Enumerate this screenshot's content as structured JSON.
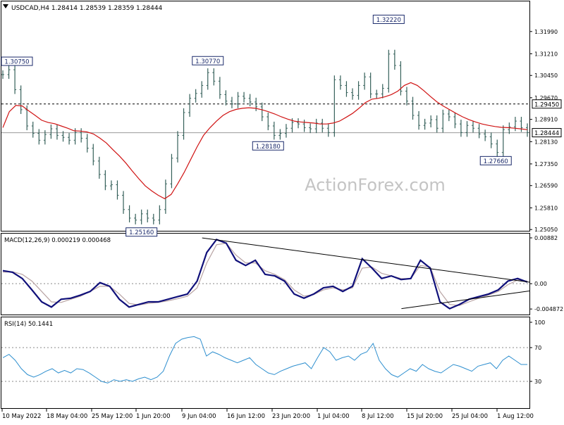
{
  "header": {
    "symbol_line": "USDCAD,H4  1.28414 1.28539 1.28359 1.28444",
    "watermark": "ActionForex.com"
  },
  "colors": {
    "price_bar": "#35605a",
    "ma_line": "#d01414",
    "macd_line": "#10107a",
    "signal_line": "#b8a3a3",
    "rsi_line": "#2e8fcf",
    "trendline": "#000000",
    "grid_text": "#000000",
    "watermark": "#c4c4c4"
  },
  "chart_data": [
    {
      "panel": "price",
      "type": "ohlc-bar",
      "title": "USDCAD,H4  1.28414 1.28539 1.28359 1.28444",
      "ylim": [
        1.2503,
        1.327
      ],
      "y_ticks": [
        "1.31990",
        "1.31210",
        "1.30450",
        "1.29670",
        "1.28910",
        "1.28130",
        "1.27350",
        "1.26590",
        "1.25810",
        "1.25050"
      ],
      "x_ticks": [
        "10 May 2022",
        "18 May 04:00",
        "25 May 12:00",
        "1 Jun 20:00",
        "9 Jun 04:00",
        "16 Jun 12:00",
        "23 Jun 20:00",
        "1 Jul 04:00",
        "8 Jul 12:00",
        "15 Jul 20:00",
        "25 Jul 04:00",
        "1 Aug 12:00"
      ],
      "series": [
        {
          "type": "line",
          "values": [
            1.3048,
            1.3065,
            1.2995,
            1.2925,
            1.2868,
            1.2842,
            1.2818,
            1.2838,
            1.2858,
            1.2835,
            1.2828,
            1.2818,
            1.2845,
            1.2825,
            1.279,
            1.2745,
            1.2698,
            1.2658,
            1.2662,
            1.2625,
            1.2575,
            1.2545,
            1.2538,
            1.256,
            1.2545,
            1.2538,
            1.2575,
            1.2665,
            1.2755,
            1.2835,
            1.2915,
            1.2965,
            1.2982,
            1.301,
            1.3055,
            1.3025,
            1.2978,
            1.2955,
            1.2945,
            1.2972,
            1.2965,
            1.2952,
            1.2935,
            1.29,
            1.2868,
            1.2835,
            1.2842,
            1.286,
            1.288,
            1.2875,
            1.2862,
            1.2858,
            1.2878,
            1.286,
            1.2845,
            1.303,
            1.301,
            1.2985,
            1.2975,
            1.301,
            1.304,
            1.298,
            1.298,
            1.3,
            1.312,
            1.308,
            1.299,
            1.2955,
            1.2905,
            1.287,
            1.2878,
            1.289,
            1.286,
            1.291,
            1.29,
            1.2875,
            1.2845,
            1.287,
            1.286,
            1.284,
            1.283,
            1.2805,
            1.2775,
            1.2855,
            1.2865,
            1.2885,
            1.2862,
            1.2845
          ]
        },
        {
          "name": "MA",
          "type": "line",
          "values": [
            1.2862,
            1.2918,
            1.294,
            1.2938,
            1.2921,
            1.2905,
            1.2888,
            1.288,
            1.2876,
            1.2868,
            1.286,
            1.2851,
            1.285,
            1.2847,
            1.284,
            1.2825,
            1.2808,
            1.2785,
            1.2763,
            1.2738,
            1.271,
            1.2683,
            1.2658,
            1.264,
            1.2625,
            1.2613,
            1.2628,
            1.2665,
            1.2705,
            1.275,
            1.2795,
            1.2835,
            1.2862,
            1.2885,
            1.2905,
            1.2918,
            1.2926,
            1.293,
            1.2932,
            1.293,
            1.2925,
            1.2918,
            1.291,
            1.29,
            1.2892,
            1.2885,
            1.2882,
            1.288,
            1.2878,
            1.2875,
            1.2875,
            1.2878,
            1.2885,
            1.2898,
            1.2912,
            1.293,
            1.295,
            1.2962,
            1.2965,
            1.297,
            1.2978,
            1.299,
            1.301,
            1.302,
            1.301,
            1.2992,
            1.2972,
            1.2953,
            1.2938,
            1.2925,
            1.2912,
            1.29,
            1.289,
            1.2882,
            1.2875,
            1.287,
            1.2866,
            1.2863,
            1.2862,
            1.286,
            1.2858,
            1.2855
          ]
        }
      ],
      "reference_lines": [
        {
          "value": 1.2945,
          "label": "1.29450",
          "style": "dashed"
        },
        {
          "value": 1.28444,
          "label": "1.28444",
          "style": "solid"
        }
      ],
      "annotations": [
        "1.30750",
        "1.30770",
        "1.32220",
        "1.28180",
        "1.25160",
        "1.27660"
      ]
    },
    {
      "panel": "macd",
      "type": "line",
      "title": "MACD(12,26,9) 0.000219 0.000468",
      "ylim": [
        -0.0058,
        0.0095
      ],
      "y_ticks": [
        "0.00882",
        "0.00",
        "-0.004872"
      ],
      "series": [
        {
          "type": "line",
          "values": [
            0.0025,
            0.0022,
            0.001,
            -0.0012,
            -0.0035,
            -0.0045,
            -0.003,
            -0.0028,
            -0.0022,
            -0.0015,
            0.0002,
            -0.0005,
            -0.003,
            -0.0045,
            -0.004,
            -0.0035,
            -0.0035,
            -0.003,
            -0.0025,
            -0.002,
            0.0005,
            0.006,
            0.0085,
            0.0078,
            0.0045,
            0.0035,
            0.0045,
            0.0018,
            0.0015,
            0.0005,
            -0.002,
            -0.0028,
            -0.002,
            -0.0008,
            -0.0005,
            -0.0015,
            -0.0005,
            0.0048,
            0.003,
            0.001,
            0.0015,
            0.0008,
            0.001,
            0.0045,
            0.003,
            -0.0035,
            -0.0048,
            -0.004,
            -0.003,
            -0.0025,
            -0.002,
            -0.0012,
            0.0005,
            0.001,
            0.0003
          ]
        },
        {
          "name": "Signal",
          "type": "line",
          "values": [
            0.0022,
            0.0023,
            0.0018,
            0.0005,
            -0.0015,
            -0.0035,
            -0.0036,
            -0.003,
            -0.0024,
            -0.0015,
            -0.0005,
            -0.0005,
            -0.002,
            -0.0038,
            -0.0041,
            -0.0038,
            -0.0036,
            -0.0033,
            -0.0029,
            -0.0024,
            -0.0008,
            0.004,
            0.0075,
            0.0078,
            0.0055,
            0.004,
            0.004,
            0.0025,
            0.0018,
            0.0008,
            -0.0012,
            -0.0024,
            -0.0021,
            -0.0012,
            -0.0008,
            -0.0012,
            -0.0008,
            0.003,
            0.0032,
            0.002,
            0.0015,
            0.001,
            0.001,
            0.0035,
            0.0032,
            -0.0015,
            -0.004,
            -0.0042,
            -0.0035,
            -0.0028,
            -0.0022,
            -0.0015,
            -0.0002,
            0.0007,
            0.0005
          ]
        }
      ],
      "trendlines": [
        {
          "from": [
            0.38,
            0.0088
          ],
          "to": [
            1.0,
            0.0003
          ]
        },
        {
          "from": [
            0.76,
            -0.0048
          ],
          "to": [
            1.0,
            -0.0014
          ]
        }
      ]
    },
    {
      "panel": "rsi",
      "type": "line",
      "title": "RSI(14) 50.1441",
      "ylim": [
        0,
        100
      ],
      "y_ticks": [
        "100",
        "70",
        "30",
        "0"
      ],
      "levels": [
        70,
        30
      ],
      "series": [
        {
          "type": "line",
          "values": [
            58,
            62,
            55,
            45,
            38,
            35,
            38,
            42,
            45,
            40,
            43,
            40,
            45,
            44,
            40,
            35,
            30,
            28,
            32,
            30,
            32,
            30,
            33,
            35,
            32,
            35,
            42,
            60,
            75,
            80,
            82,
            83,
            80,
            60,
            65,
            62,
            58,
            55,
            52,
            55,
            58,
            50,
            45,
            40,
            38,
            42,
            45,
            48,
            50,
            52,
            45,
            58,
            70,
            65,
            55,
            58,
            60,
            55,
            62,
            65,
            75,
            55,
            45,
            38,
            35,
            40,
            45,
            42,
            50,
            45,
            42,
            40,
            45,
            50,
            48,
            45,
            42,
            48,
            50,
            52,
            45,
            55,
            60,
            55,
            50,
            50
          ]
        }
      ]
    }
  ]
}
